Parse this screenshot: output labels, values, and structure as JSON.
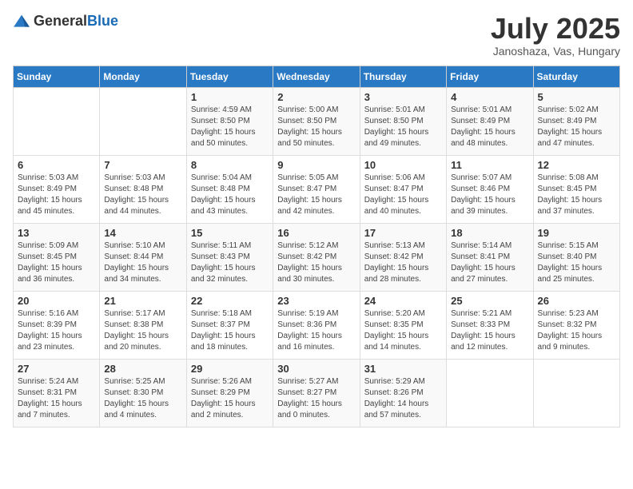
{
  "logo": {
    "general": "General",
    "blue": "Blue"
  },
  "title": "July 2025",
  "location": "Janoshaza, Vas, Hungary",
  "days_of_week": [
    "Sunday",
    "Monday",
    "Tuesday",
    "Wednesday",
    "Thursday",
    "Friday",
    "Saturday"
  ],
  "weeks": [
    [
      {
        "day": "",
        "info": ""
      },
      {
        "day": "",
        "info": ""
      },
      {
        "day": "1",
        "info": "Sunrise: 4:59 AM\nSunset: 8:50 PM\nDaylight: 15 hours and 50 minutes."
      },
      {
        "day": "2",
        "info": "Sunrise: 5:00 AM\nSunset: 8:50 PM\nDaylight: 15 hours and 50 minutes."
      },
      {
        "day": "3",
        "info": "Sunrise: 5:01 AM\nSunset: 8:50 PM\nDaylight: 15 hours and 49 minutes."
      },
      {
        "day": "4",
        "info": "Sunrise: 5:01 AM\nSunset: 8:49 PM\nDaylight: 15 hours and 48 minutes."
      },
      {
        "day": "5",
        "info": "Sunrise: 5:02 AM\nSunset: 8:49 PM\nDaylight: 15 hours and 47 minutes."
      }
    ],
    [
      {
        "day": "6",
        "info": "Sunrise: 5:03 AM\nSunset: 8:49 PM\nDaylight: 15 hours and 45 minutes."
      },
      {
        "day": "7",
        "info": "Sunrise: 5:03 AM\nSunset: 8:48 PM\nDaylight: 15 hours and 44 minutes."
      },
      {
        "day": "8",
        "info": "Sunrise: 5:04 AM\nSunset: 8:48 PM\nDaylight: 15 hours and 43 minutes."
      },
      {
        "day": "9",
        "info": "Sunrise: 5:05 AM\nSunset: 8:47 PM\nDaylight: 15 hours and 42 minutes."
      },
      {
        "day": "10",
        "info": "Sunrise: 5:06 AM\nSunset: 8:47 PM\nDaylight: 15 hours and 40 minutes."
      },
      {
        "day": "11",
        "info": "Sunrise: 5:07 AM\nSunset: 8:46 PM\nDaylight: 15 hours and 39 minutes."
      },
      {
        "day": "12",
        "info": "Sunrise: 5:08 AM\nSunset: 8:45 PM\nDaylight: 15 hours and 37 minutes."
      }
    ],
    [
      {
        "day": "13",
        "info": "Sunrise: 5:09 AM\nSunset: 8:45 PM\nDaylight: 15 hours and 36 minutes."
      },
      {
        "day": "14",
        "info": "Sunrise: 5:10 AM\nSunset: 8:44 PM\nDaylight: 15 hours and 34 minutes."
      },
      {
        "day": "15",
        "info": "Sunrise: 5:11 AM\nSunset: 8:43 PM\nDaylight: 15 hours and 32 minutes."
      },
      {
        "day": "16",
        "info": "Sunrise: 5:12 AM\nSunset: 8:42 PM\nDaylight: 15 hours and 30 minutes."
      },
      {
        "day": "17",
        "info": "Sunrise: 5:13 AM\nSunset: 8:42 PM\nDaylight: 15 hours and 28 minutes."
      },
      {
        "day": "18",
        "info": "Sunrise: 5:14 AM\nSunset: 8:41 PM\nDaylight: 15 hours and 27 minutes."
      },
      {
        "day": "19",
        "info": "Sunrise: 5:15 AM\nSunset: 8:40 PM\nDaylight: 15 hours and 25 minutes."
      }
    ],
    [
      {
        "day": "20",
        "info": "Sunrise: 5:16 AM\nSunset: 8:39 PM\nDaylight: 15 hours and 23 minutes."
      },
      {
        "day": "21",
        "info": "Sunrise: 5:17 AM\nSunset: 8:38 PM\nDaylight: 15 hours and 20 minutes."
      },
      {
        "day": "22",
        "info": "Sunrise: 5:18 AM\nSunset: 8:37 PM\nDaylight: 15 hours and 18 minutes."
      },
      {
        "day": "23",
        "info": "Sunrise: 5:19 AM\nSunset: 8:36 PM\nDaylight: 15 hours and 16 minutes."
      },
      {
        "day": "24",
        "info": "Sunrise: 5:20 AM\nSunset: 8:35 PM\nDaylight: 15 hours and 14 minutes."
      },
      {
        "day": "25",
        "info": "Sunrise: 5:21 AM\nSunset: 8:33 PM\nDaylight: 15 hours and 12 minutes."
      },
      {
        "day": "26",
        "info": "Sunrise: 5:23 AM\nSunset: 8:32 PM\nDaylight: 15 hours and 9 minutes."
      }
    ],
    [
      {
        "day": "27",
        "info": "Sunrise: 5:24 AM\nSunset: 8:31 PM\nDaylight: 15 hours and 7 minutes."
      },
      {
        "day": "28",
        "info": "Sunrise: 5:25 AM\nSunset: 8:30 PM\nDaylight: 15 hours and 4 minutes."
      },
      {
        "day": "29",
        "info": "Sunrise: 5:26 AM\nSunset: 8:29 PM\nDaylight: 15 hours and 2 minutes."
      },
      {
        "day": "30",
        "info": "Sunrise: 5:27 AM\nSunset: 8:27 PM\nDaylight: 15 hours and 0 minutes."
      },
      {
        "day": "31",
        "info": "Sunrise: 5:29 AM\nSunset: 8:26 PM\nDaylight: 14 hours and 57 minutes."
      },
      {
        "day": "",
        "info": ""
      },
      {
        "day": "",
        "info": ""
      }
    ]
  ]
}
